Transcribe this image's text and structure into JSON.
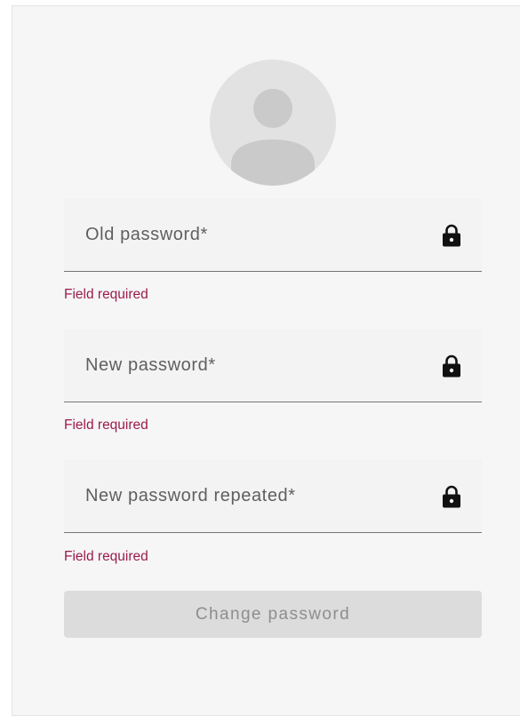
{
  "avatar": {
    "icon": "account-circle-icon"
  },
  "fields": [
    {
      "placeholder": "Old password*",
      "value": "",
      "icon": "lock-icon",
      "error": "Field required"
    },
    {
      "placeholder": "New password*",
      "value": "",
      "icon": "lock-icon",
      "error": "Field required"
    },
    {
      "placeholder": "New password repeated*",
      "value": "",
      "icon": "lock-icon",
      "error": "Field required"
    }
  ],
  "submit": {
    "label": "Change password",
    "disabled": true
  },
  "colors": {
    "card_background": "#f6f6f6",
    "error": "#9b1b4b",
    "button_disabled_bg": "#dcdcdc",
    "button_disabled_text": "#8e8e8e",
    "avatar_bg": "#e2e2e2",
    "avatar_fg": "#cacaca"
  }
}
